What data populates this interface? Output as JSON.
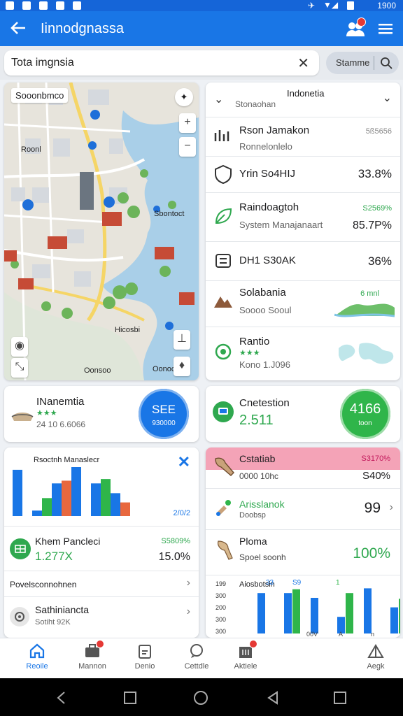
{
  "status_bar": {
    "time": "1900"
  },
  "app_bar": {
    "title": "Iinnodgnassa"
  },
  "search": {
    "value": "Tota imgnsia",
    "segment_label": "Stamme"
  },
  "map": {
    "top_label": "Sooonbmco",
    "label_left": "Roonl",
    "label_mid": "Sbontoct",
    "label_bottom": "Hicosbi",
    "label_corner": "Oonsoo",
    "label_corner2": "Oonoc"
  },
  "list": {
    "header_title": "Indonetia",
    "header_sub": "Stonaohan",
    "rows": [
      {
        "name": "Rson Jamakon",
        "sub": "Ronnelonlelo",
        "val": "",
        "val_small": "5ß5656",
        "icon": "stats-icon"
      },
      {
        "name": "Yrin So4HIJ",
        "sub": "",
        "val": "33.8%",
        "val_small": "",
        "icon": "shield-icon"
      },
      {
        "name": "Raindoagtoh",
        "sub": "System Manajanaart",
        "val": "85.7P%",
        "val_small": "S2569%",
        "icon": "leaf-icon"
      },
      {
        "name": "DH1 S30AK",
        "sub": "",
        "val": "36%",
        "val_small": "",
        "icon": "box-icon"
      },
      {
        "name": "Solabania",
        "sub": "Soooo Sooul",
        "val": "",
        "val_small": "6 mnl",
        "icon": "mountain-icon"
      },
      {
        "name": "Rantio",
        "sub": "Kono 1.J096",
        "val": "",
        "val_small": "",
        "sub_green": "★★★",
        "icon": "recycle-icon"
      }
    ]
  },
  "stat1": {
    "title": "INanemtia",
    "stars": "★★★",
    "sub": "24 10 6.6066",
    "ring_main": "SEE",
    "ring_sub": "930000"
  },
  "stat2": {
    "title": "Cnetestion",
    "value": "2.511",
    "ring_main": "4166",
    "ring_sub": "toon"
  },
  "chart_card": {
    "title": "Rsoctnh Manaslecr",
    "foot": "2/0/2",
    "kpi_label": "Khem Pancleci",
    "kpi_sub": "1.277X",
    "kpi_green": "S5809%",
    "kpi_val": "15.0%",
    "row1": "Povelsconnohnen",
    "row2": "Sathiniancta",
    "row2_sub": "Sotiht 92K"
  },
  "chart_data": {
    "type": "bar",
    "bar_series": [
      {
        "name": "",
        "color": "#1976e6",
        "values": [
          8.5,
          1,
          6,
          9,
          6,
          4.2
        ]
      },
      {
        "name": "",
        "color": "#2fb54a",
        "values": [
          0,
          3.3,
          0,
          0,
          6.8,
          0
        ]
      },
      {
        "name": "",
        "color": "#e8683e",
        "values": [
          0,
          0,
          6.5,
          0,
          0,
          2.5
        ]
      }
    ],
    "right_chart": {
      "yticks": [
        "199",
        "300",
        "200",
        "300",
        "300"
      ],
      "top_labels": [
        "33",
        "S9",
        "1"
      ],
      "xlabels": [
        "",
        "00V",
        "A",
        "n"
      ],
      "title": "Aiosbotsin",
      "series_blue": [
        8.5,
        8.5,
        7.5,
        3.5,
        9.5,
        5.5
      ],
      "series_green": [
        0,
        9.3,
        0,
        8.5,
        0,
        7.3
      ]
    }
  },
  "right_card": {
    "r1_title": "Cstatiab",
    "r1_sub": "0000 10hc",
    "r1_green": "S3170%",
    "r1_val": "S40%",
    "r2_title": "Arisslanok",
    "r2_sub": "Doobsp",
    "r2_val": "99",
    "r3_title": "Ploma",
    "r3_sub": "Spoel soonh",
    "r3_val": "100%"
  },
  "bottom_nav": [
    {
      "label": "Reoile",
      "icon": "home-icon"
    },
    {
      "label": "Mannon",
      "icon": "briefcase-icon"
    },
    {
      "label": "Denio",
      "icon": "clipboard-icon"
    },
    {
      "label": "Cettdle",
      "icon": "chat-icon"
    },
    {
      "label": "Aktiele",
      "icon": "building-icon"
    },
    {
      "label": "",
      "icon": ""
    },
    {
      "label": "Aegk",
      "icon": "tent-icon"
    }
  ],
  "colors": {
    "primary": "#1976e6",
    "green": "#2fb54a",
    "pink": "#f4a3b7"
  }
}
